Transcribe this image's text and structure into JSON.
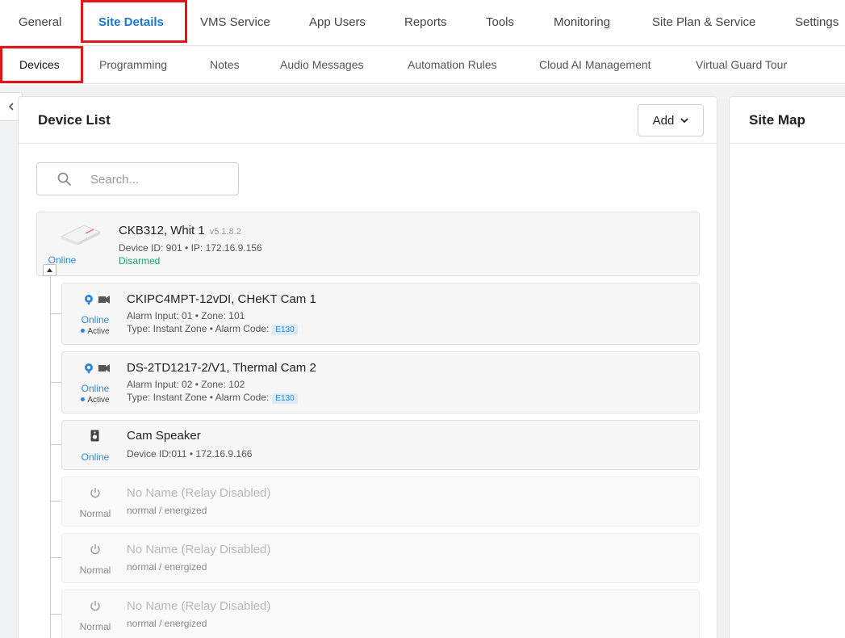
{
  "top_tabs": [
    "General",
    "Site Details",
    "VMS Service",
    "App Users",
    "Reports",
    "Tools",
    "Monitoring",
    "Site Plan & Service",
    "Settings"
  ],
  "sub_tabs": [
    "Devices",
    "Programming",
    "Notes",
    "Audio Messages",
    "Automation Rules",
    "Cloud AI Management",
    "Virtual Guard Tour"
  ],
  "device_list": {
    "title": "Device List",
    "add_label": "Add",
    "search_placeholder": "Search..."
  },
  "site_map": {
    "title": "Site Map"
  },
  "panel_device": {
    "name": "CKB312, Whit 1",
    "version": "v5.1.8.2",
    "info": "Device ID: 901 • IP: 172.16.9.156",
    "state": "Disarmed",
    "status": "Online"
  },
  "cameras": [
    {
      "name": "CKIPC4MPT-12vDI, CHeKT Cam 1",
      "line1": "Alarm Input: 01 • Zone: 101",
      "line2": "Type: Instant Zone • Alarm Code:",
      "code": "E130",
      "status": "Online",
      "active": "Active"
    },
    {
      "name": "DS-2TD1217-2/V1, Thermal Cam 2",
      "line1": "Alarm Input: 02 • Zone: 102",
      "line2": "Type: Instant Zone • Alarm Code:",
      "code": "E130",
      "status": "Online",
      "active": "Active"
    }
  ],
  "speaker": {
    "name": "Cam Speaker",
    "info": "Device ID:011 • 172.16.9.166",
    "status": "Online"
  },
  "relays": [
    {
      "name": "No Name (Relay Disabled)",
      "info": "normal / energized",
      "status": "Normal"
    },
    {
      "name": "No Name (Relay Disabled)",
      "info": "normal / energized",
      "status": "Normal"
    },
    {
      "name": "No Name (Relay Disabled)",
      "info": "normal / energized",
      "status": "Normal"
    }
  ],
  "colors": {
    "accent": "#1976d2",
    "highlight": "#e0161b",
    "online": "#2b87d8",
    "disarmed": "#1aa36b"
  }
}
